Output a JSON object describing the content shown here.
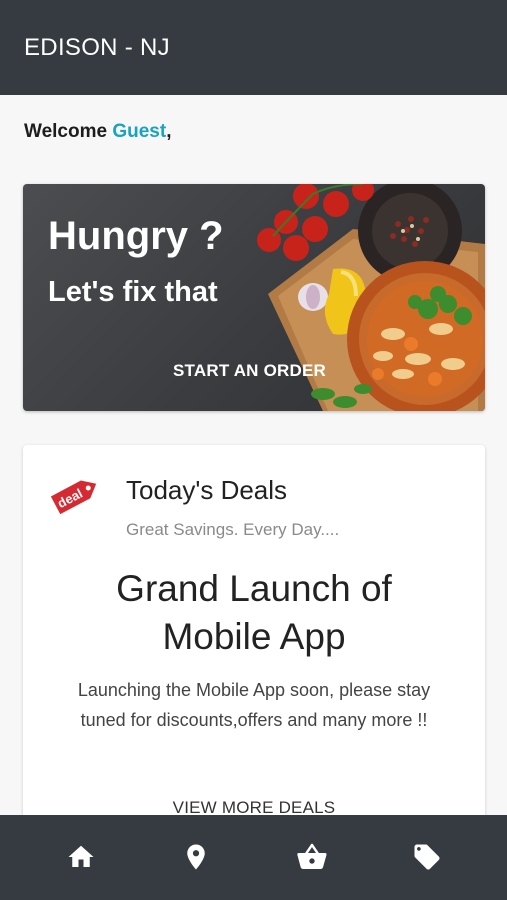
{
  "header": {
    "title": "EDISON - NJ"
  },
  "welcome": {
    "prefix": "Welcome ",
    "name": "Guest",
    "suffix": ","
  },
  "hero": {
    "line1": "Hungry ?",
    "line2": "Let's fix that",
    "cta": "START AN ORDER"
  },
  "deals": {
    "icon_label": "deal",
    "title": "Today's Deals",
    "subtitle": "Great Savings. Every Day....",
    "headline_1": "Grand Launch of",
    "headline_2": "Mobile App",
    "body_1": "Launching the Mobile App soon, please stay",
    "body_2": "tuned for discounts,offers and many more !!",
    "more": "VIEW MORE DEALS"
  },
  "bottom_nav": [
    {
      "icon": "home-icon"
    },
    {
      "icon": "location-pin-icon"
    },
    {
      "icon": "basket-icon"
    },
    {
      "icon": "tag-icon"
    }
  ],
  "colors": {
    "bar": "#363b42",
    "accent": "#1aa3c0",
    "deal_red": "#d62a32"
  }
}
